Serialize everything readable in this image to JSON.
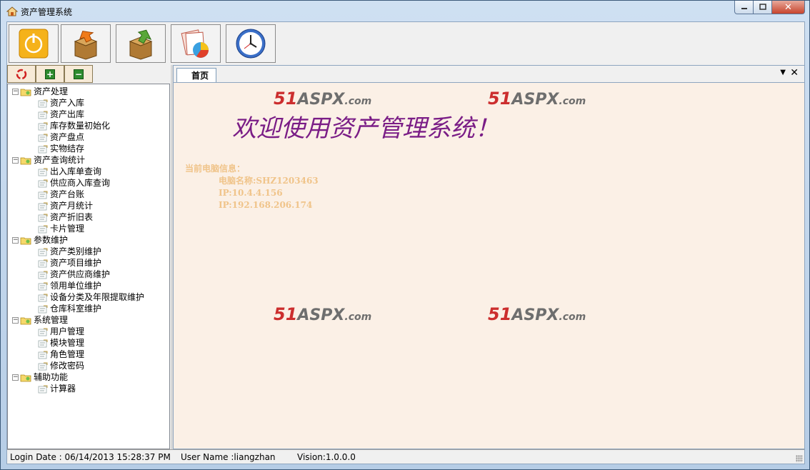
{
  "window": {
    "title": "资产管理系统",
    "min_label": "▭",
    "max_label": "□",
    "close_label": "✕"
  },
  "toolbar": {
    "buttons": [
      {
        "icon": "power-icon"
      },
      {
        "icon": "box-out-icon"
      },
      {
        "icon": "box-in-icon"
      },
      {
        "icon": "pie-chart-report-icon"
      },
      {
        "icon": "clock-icon"
      }
    ]
  },
  "left_tools": {
    "refresh_icon": "recycle-icon",
    "expand_label": "+",
    "collapse_label": "−"
  },
  "tree": {
    "groups": [
      {
        "label": "资产处理",
        "items": [
          "资产入库",
          "资产出库",
          "库存数量初始化",
          "资产盘点",
          "实物结存"
        ]
      },
      {
        "label": "资产查询统计",
        "items": [
          "出入库单查询",
          "供应商入库查询",
          "资产台账",
          "资产月统计",
          "资产折旧表",
          "卡片管理"
        ]
      },
      {
        "label": "参数维护",
        "items": [
          "资产类别维护",
          "资产项目维护",
          "资产供应商维护",
          "领用单位维护",
          "设备分类及年限提取维护",
          "仓库科室维护"
        ]
      },
      {
        "label": "系统管理",
        "items": [
          "用户管理",
          "模块管理",
          "角色管理",
          "修改密码"
        ]
      },
      {
        "label": "辅助功能",
        "items": [
          "计算器"
        ]
      }
    ]
  },
  "tabs": {
    "active_label": "首页",
    "dropdown_label": "▼",
    "close_label": "✕"
  },
  "content": {
    "welcome": "欢迎使用资产管理系统！",
    "pc_info_title": "当前电脑信息：",
    "pc_name": "电脑名称:SHZ1203463",
    "ip1": "IP:10.4.4.156",
    "ip2": "IP:192.168.206.174",
    "watermark_a": "51",
    "watermark_b": "ASPX",
    "watermark_c": ".com"
  },
  "status": {
    "login_date": "Login Date : 06/14/2013 15:28:37 PM",
    "user_name": "User Name :liangzhan",
    "version": "Vision:1.0.0.0"
  }
}
